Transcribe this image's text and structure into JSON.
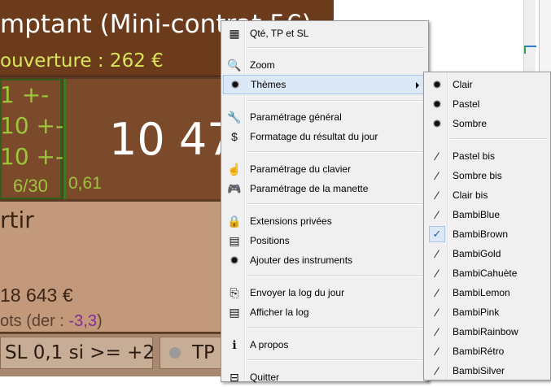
{
  "app": {
    "title": "mptant (Mini-contrat 5€)",
    "subtitle": "ouverture : 262 €",
    "qty_rows": [
      "1 +-",
      "10 +-",
      "10 +-"
    ],
    "qty_small": "6/30",
    "big_value": "10 47",
    "small_value": "0,61",
    "section_title": "rtir",
    "section_amount": "18 643 €",
    "lots_prefix": "ots (der : ",
    "lots_value": "-3,3",
    "lots_suffix": ")",
    "sl_label": "SL 0,1 si >= +2",
    "tp_label": "TP"
  },
  "context_menu": {
    "items": [
      {
        "label": "Qté, TP et SL",
        "icon": "calculator-icon",
        "glyph": "▦"
      },
      {
        "label": "Zoom",
        "icon": "magnifier-icon",
        "glyph": "🔍"
      },
      {
        "label": "Thèmes",
        "icon": "burst-icon",
        "glyph": "✹"
      },
      {
        "label": "Paramétrage général",
        "icon": "wrench-icon",
        "glyph": "🔧"
      },
      {
        "label": "Formatage du résultat du jour",
        "icon": "dollar-icon",
        "glyph": "$"
      },
      {
        "label": "Paramétrage du clavier",
        "icon": "pointer-hand-icon",
        "glyph": "☝"
      },
      {
        "label": "Paramétrage de la manette",
        "icon": "gamepad-icon",
        "glyph": "🎮"
      },
      {
        "label": "Extensions privées",
        "icon": "lock-icon",
        "glyph": "🔒"
      },
      {
        "label": "Positions",
        "icon": "list-icon",
        "glyph": "▤"
      },
      {
        "label": "Ajouter des instruments",
        "icon": "burst-icon",
        "glyph": "✹"
      },
      {
        "label": "Envoyer la log du jour",
        "icon": "send-document-icon",
        "glyph": "⎘"
      },
      {
        "label": "Afficher la log",
        "icon": "document-icon",
        "glyph": "▤"
      },
      {
        "label": "A propos",
        "icon": "info-icon",
        "glyph": "ℹ"
      },
      {
        "label": "Quitter",
        "icon": "exit-icon",
        "glyph": "⊟"
      }
    ]
  },
  "themes_menu": {
    "items": [
      {
        "label": "Clair",
        "icon": "burst-icon",
        "glyph": "✹"
      },
      {
        "label": "Pastel",
        "icon": "burst-icon",
        "glyph": "✹"
      },
      {
        "label": "Sombre",
        "icon": "burst-icon",
        "glyph": "✹"
      },
      {
        "label": "Pastel bis",
        "icon": "magic-wand-icon",
        "glyph": "⁄"
      },
      {
        "label": "Sombre bis",
        "icon": "magic-wand-icon",
        "glyph": "⁄"
      },
      {
        "label": "Clair bis",
        "icon": "magic-wand-icon",
        "glyph": "⁄"
      },
      {
        "label": "BambiBlue",
        "icon": "magic-wand-icon",
        "glyph": "⁄"
      },
      {
        "label": "BambiBrown",
        "icon": "checkmark-icon",
        "glyph": "✓",
        "checked": true
      },
      {
        "label": "BambiGold",
        "icon": "magic-wand-icon",
        "glyph": "⁄"
      },
      {
        "label": "BambiCahuète",
        "icon": "magic-wand-icon",
        "glyph": "⁄"
      },
      {
        "label": "BambiLemon",
        "icon": "magic-wand-icon",
        "glyph": "⁄"
      },
      {
        "label": "BambiPink",
        "icon": "magic-wand-icon",
        "glyph": "⁄"
      },
      {
        "label": "BambiRainbow",
        "icon": "magic-wand-icon",
        "glyph": "⁄"
      },
      {
        "label": "BambiRétro",
        "icon": "magic-wand-icon",
        "glyph": "⁄"
      },
      {
        "label": "BambiSilver",
        "icon": "magic-wand-icon",
        "glyph": "⁄"
      }
    ]
  },
  "colors": {
    "header_bg": "#6b3b1c",
    "accent_green": "#9cc43c",
    "subtitle_yellow": "#d9e55a",
    "menu_bg": "#f0f0f0",
    "menu_highlight": "#dbe8f7"
  }
}
